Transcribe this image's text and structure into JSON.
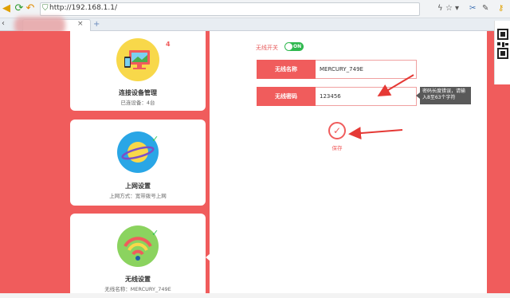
{
  "browser": {
    "url": "http://192.168.1.1/",
    "tab_close": "×",
    "tab_new": "+",
    "icons": [
      "back-icon",
      "refresh-icon",
      "undo-icon",
      "star-icon",
      "scissors-icon",
      "wrench-icon",
      "key-icon"
    ]
  },
  "cards": [
    {
      "title": "连接设备管理",
      "subtitle": "已连设备：4台",
      "badge": "4"
    },
    {
      "title": "上网设置",
      "subtitle": "上网方式：宽带拨号上网",
      "badge": "✓"
    },
    {
      "title": "无线设置",
      "subtitle": "无线名称：MERCURY_749E",
      "badge": "✓"
    }
  ],
  "form": {
    "wifi_switch_label": "无线开关",
    "toggle_text": "ON",
    "ssid_label": "无线名称",
    "ssid_value": "MERCURY_749E",
    "password_label": "无线密码",
    "password_value": "123456",
    "tooltip": "密码长度错误，请输入8至63个字符",
    "save_label": "保存"
  },
  "colors": {
    "brand": "#f05c5c",
    "toggle_on": "#2fb84f",
    "check": "#34c759"
  }
}
